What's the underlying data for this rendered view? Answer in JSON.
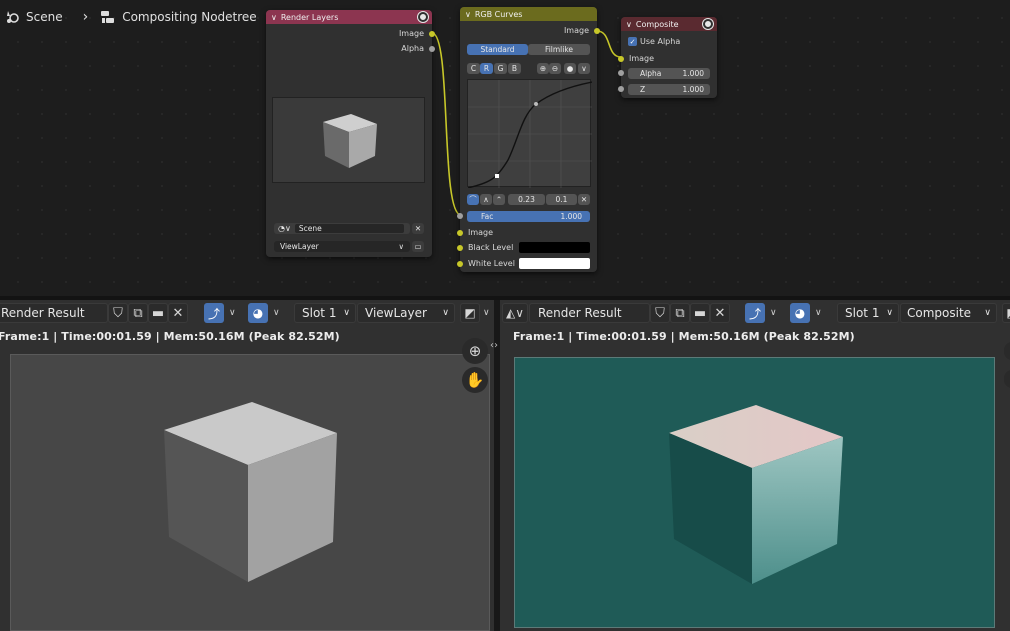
{
  "breadcrumb": {
    "scene": "Scene",
    "separator": "›",
    "nodetree": "Compositing Nodetree"
  },
  "nodes": {
    "render_layers": {
      "title": "Render Layers",
      "outputs": [
        "Image",
        "Alpha"
      ],
      "scene_field": "Scene",
      "layer_field": "ViewLayer",
      "header_color": "#8c3550"
    },
    "rgb_curves": {
      "title": "RGB Curves",
      "header_color": "#6b6b1e",
      "output": "Image",
      "tabs": [
        "Standard",
        "Filmlike"
      ],
      "channels": [
        "C",
        "R",
        "G",
        "B"
      ],
      "active_channel": "R",
      "point_values": [
        "0.23",
        "0.1"
      ],
      "fac_label": "Fac",
      "fac_value": "1.000",
      "inputs": [
        "Image",
        "Black Level",
        "White Level"
      ]
    },
    "composite": {
      "title": "Composite",
      "header_color": "#5a2a30",
      "use_alpha": "Use Alpha",
      "input": "Image",
      "alpha_label": "Alpha",
      "alpha_value": "1.000",
      "z_label": "Z",
      "z_value": "1.000"
    }
  },
  "left_viewer": {
    "image_name": "Render Result",
    "slot": "Slot 1",
    "layer": "ViewLayer",
    "status": "Frame:1 | Time:00:01.59 | Mem:50.16M (Peak 82.52M)",
    "bg_color": "#474747"
  },
  "right_viewer": {
    "image_name": "Render Result",
    "slot": "Slot 1",
    "layer": "Composite",
    "status": "Frame:1 | Time:00:01.59 | Mem:50.16M (Peak 82.52M)",
    "bg_color": "#1f5b57"
  },
  "colors": {
    "accent": "#4772b3",
    "socket_yellow": "#c7c729",
    "socket_gray": "#a0a0a0"
  }
}
